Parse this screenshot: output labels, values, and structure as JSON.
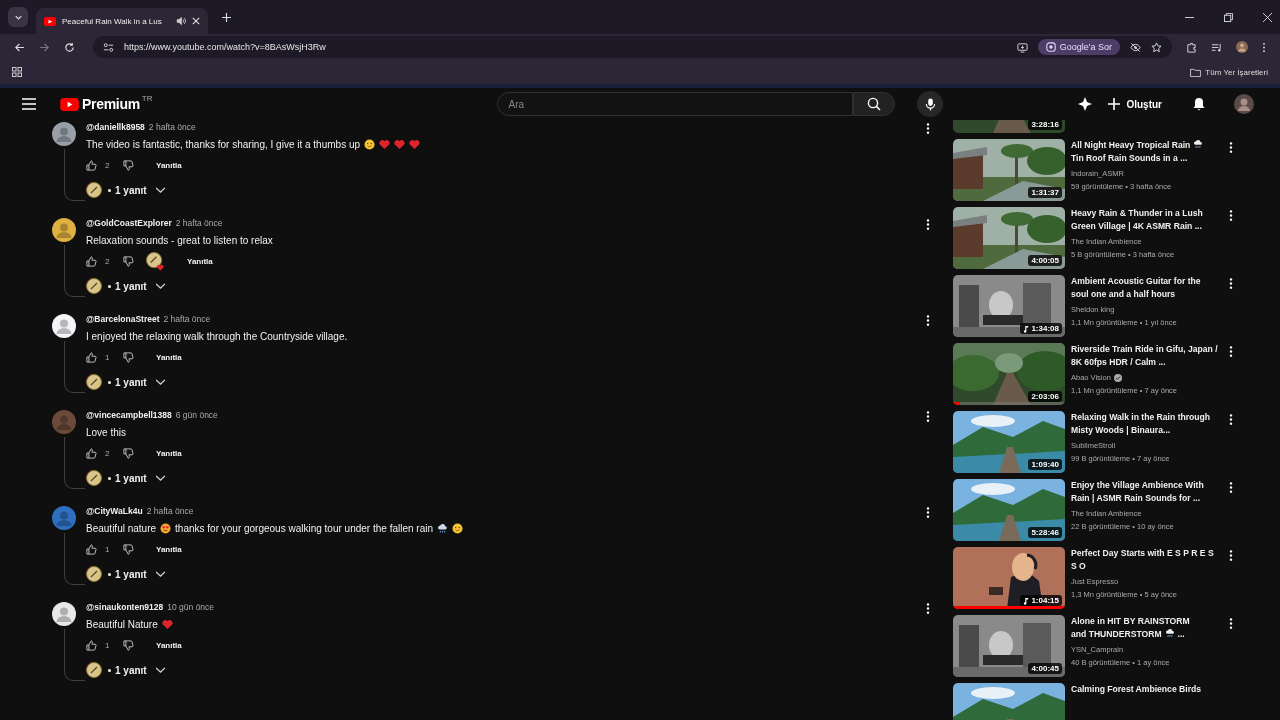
{
  "browser": {
    "tab": {
      "title": "Peaceful Rain Walk in a Lus",
      "audio": true
    },
    "url": "https://www.youtube.com/watch?v=8BAsWsjH3Rw",
    "ask_google": "Google'a Sor",
    "bookmarks_folder": "Tüm Yer İşaretleri"
  },
  "header": {
    "logo": "Premium",
    "region": "TR",
    "search": {
      "placeholder": "Ara"
    },
    "create": "Oluştur"
  },
  "comments": [
    {
      "user": "@daniellk8958",
      "time": "2 hafta önce",
      "color": "#9aa0a8",
      "parts": [
        {
          "kind": "text",
          "text": "The video is fantastic, thanks for sharing, I give it a thumbs up"
        },
        {
          "kind": "smile"
        },
        {
          "kind": "heart"
        },
        {
          "kind": "heart"
        },
        {
          "kind": "heart"
        }
      ],
      "likes": "2",
      "hearted": false,
      "reply": "Yanıtla",
      "replies": "1 yanıt"
    },
    {
      "user": "@GoldCoastExplorer",
      "time": "2 hafta önce",
      "color": "#e0b040",
      "parts": [
        {
          "kind": "text",
          "text": "Relaxation sounds - great to listen to relax"
        }
      ],
      "likes": "2",
      "hearted": true,
      "reply": "Yanıtla",
      "replies": "1 yanıt"
    },
    {
      "user": "@BarcelonaStreet",
      "time": "2 hafta önce",
      "color": "#f2f4f8",
      "parts": [
        {
          "kind": "text",
          "text": "I enjoyed the relaxing walk through the Countryside village."
        }
      ],
      "likes": "1",
      "hearted": false,
      "reply": "Yanıtla",
      "replies": "1 yanıt"
    },
    {
      "user": "@vincecampbell1388",
      "time": "6 gün önce",
      "color": "#6b4a3a",
      "parts": [
        {
          "kind": "text",
          "text": "Love this"
        }
      ],
      "likes": "2",
      "hearted": false,
      "reply": "Yanıtla",
      "replies": "1 yanıt"
    },
    {
      "user": "@CityWaLk4u",
      "time": "2 hafta önce",
      "color": "#2f6fc0",
      "parts": [
        {
          "kind": "text",
          "text": "Beautiful nature"
        },
        {
          "kind": "heart-eyes"
        },
        {
          "kind": "text",
          "text": "thanks for your gorgeous walking tour under the fallen rain"
        },
        {
          "kind": "rain-cloud"
        },
        {
          "kind": "smile"
        }
      ],
      "likes": "1",
      "hearted": false,
      "reply": "Yanıtla",
      "replies": "1 yanıt"
    },
    {
      "user": "@sinaukonten9128",
      "time": "10 gün önce",
      "color": "#e8e8e8",
      "parts": [
        {
          "kind": "text",
          "text": "Beautiful Nature"
        },
        {
          "kind": "heart"
        }
      ],
      "likes": "1",
      "hearted": false,
      "reply": "Yanıtla",
      "replies": "1 yanıt"
    }
  ],
  "related": [
    {
      "kind": "partial_top",
      "duration": "3:28:16",
      "music": false
    },
    {
      "kind": "video",
      "title_parts": [
        {
          "kind": "text",
          "text": "All Night Heavy Tropical Rain"
        },
        {
          "kind": "rain-cloud"
        },
        {
          "kind": "text",
          "text": "Tin Roof Rain Sounds in a ..."
        }
      ],
      "channel": "Indorain_ASMR",
      "verified": false,
      "meta": "59 görüntüleme • 3 hafta önce",
      "duration": "1:31:37",
      "music": false
    },
    {
      "kind": "video",
      "title_parts": [
        {
          "kind": "text",
          "text": "Heavy Rain & Thunder in a Lush Green Village | 4K ASMR Rain ..."
        }
      ],
      "channel": "The Indian Ambience",
      "verified": false,
      "meta": "5 B görüntüleme • 3 hafta önce",
      "duration": "4:00:05",
      "music": false
    },
    {
      "kind": "video",
      "title_parts": [
        {
          "kind": "text",
          "text": "Ambient Acoustic Guitar for the soul one and a half hours"
        }
      ],
      "channel": "Sheldon king",
      "verified": false,
      "meta": "1,1 Mn görüntüleme • 1 yıl önce",
      "duration": "1:34:08",
      "music": true
    },
    {
      "kind": "video",
      "title_parts": [
        {
          "kind": "text",
          "text": "Riverside Train Ride in Gifu, Japan / 8K 60fps HDR / Calm ..."
        }
      ],
      "channel": "Abao Vision",
      "verified": true,
      "meta": "1,1 Mn görüntüleme • 7 ay önce",
      "duration": "2:03:06",
      "music": false,
      "level": 0.06
    },
    {
      "kind": "video",
      "title_parts": [
        {
          "kind": "text",
          "text": "Relaxing Walk in the Rain through Misty Woods | Binaura..."
        }
      ],
      "channel": "SublimeStroll",
      "verified": false,
      "meta": "99 B görüntüleme • 7 ay önce",
      "duration": "1:09:40",
      "music": false
    },
    {
      "kind": "video",
      "title_parts": [
        {
          "kind": "text",
          "text": "Enjoy the Village Ambience With Rain | ASMR Rain Sounds for ..."
        }
      ],
      "channel": "The Indian Ambience",
      "verified": false,
      "meta": "22 B görüntüleme • 10 ay önce",
      "duration": "5:28:46",
      "music": false
    },
    {
      "kind": "video",
      "title_parts": [
        {
          "kind": "text",
          "text": "Perfect Day Starts with E S P R E S S O"
        }
      ],
      "channel": "Just Espresso",
      "verified": false,
      "meta": "1,3 Mn görüntüleme • 5 ay önce",
      "duration": "1:04:15",
      "music": true,
      "level": 1
    },
    {
      "kind": "video",
      "title_parts": [
        {
          "kind": "text",
          "text": "Alone in HIT BY RAINSTORM"
        },
        {
          "kind": "text",
          "text": "and THUNDERSTORM"
        },
        {
          "kind": "rain-cloud"
        },
        {
          "kind": "text",
          "text": "..."
        }
      ],
      "channel": "YSN_Camprain",
      "verified": false,
      "meta": "40 B görüntüleme • 1 ay önce",
      "duration": "4:00:45",
      "music": false
    },
    {
      "kind": "partial_bottom",
      "title_parts": [
        {
          "kind": "text",
          "text": "Calming Forest Ambience Birds"
        }
      ]
    }
  ]
}
